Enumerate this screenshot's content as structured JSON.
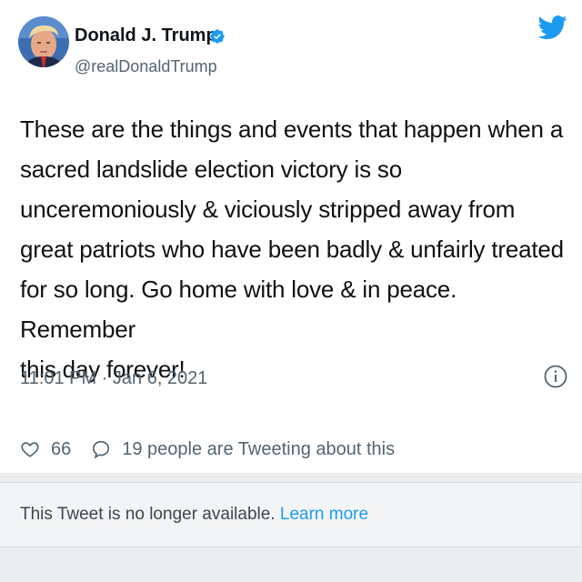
{
  "author": {
    "display_name": "Donald J. Trump",
    "handle": "@realDonaldTrump",
    "verified": true
  },
  "tweet": {
    "lines": [
      "These are the things and events that happen when a",
      "sacred landslide election victory is so",
      "unceremoniously & viciously stripped away from",
      "great patriots who have been badly & unfairly treated",
      "for so long. Go home with love & in peace. Remember",
      "this day forever!"
    ],
    "timestamp": "11:01 PM · Jan 6, 2021"
  },
  "actions": {
    "like_count": "66",
    "conversation_label": "19 people are Tweeting about this"
  },
  "notice": {
    "message": "This Tweet is no longer available.",
    "link_label": "Learn more"
  },
  "colors": {
    "twitter_blue": "#1d9bf0",
    "secondary_text": "#536471",
    "notice_background": "#f3f4f5"
  },
  "icons": [
    "avatar",
    "verified-badge-icon",
    "twitter-logo-icon",
    "info-icon",
    "heart-icon",
    "reply-icon"
  ]
}
